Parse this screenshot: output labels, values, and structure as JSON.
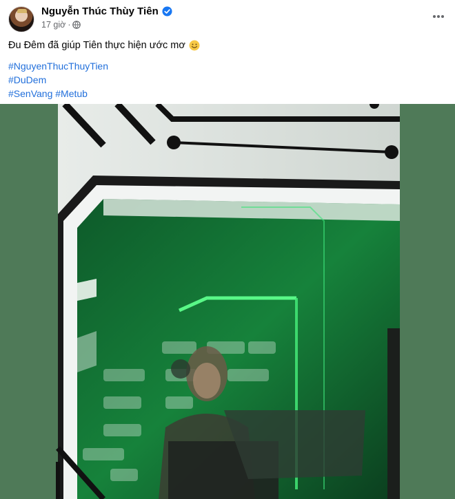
{
  "post": {
    "author_name": "Nguyễn Thúc Thùy Tiên",
    "timestamp": "17 giờ",
    "separator": "·",
    "text": "Đu Đêm đã giúp Tiên thực hiện ước mơ",
    "hashtags": {
      "line1": "#NguyenThucThuyTien",
      "line2": "#DuDem",
      "line3a": "#SenVang",
      "line3b": "#Metub"
    }
  },
  "colors": {
    "link": "#216fdb",
    "verified": "#1877f2",
    "photo_background": "#4f7a58",
    "neon": "#2ee06a"
  },
  "icons": {
    "verified": "verified-badge-icon",
    "privacy": "globe-icon",
    "more": "more-horizontal-icon",
    "emoji": "smiling-face-emoji-icon"
  }
}
